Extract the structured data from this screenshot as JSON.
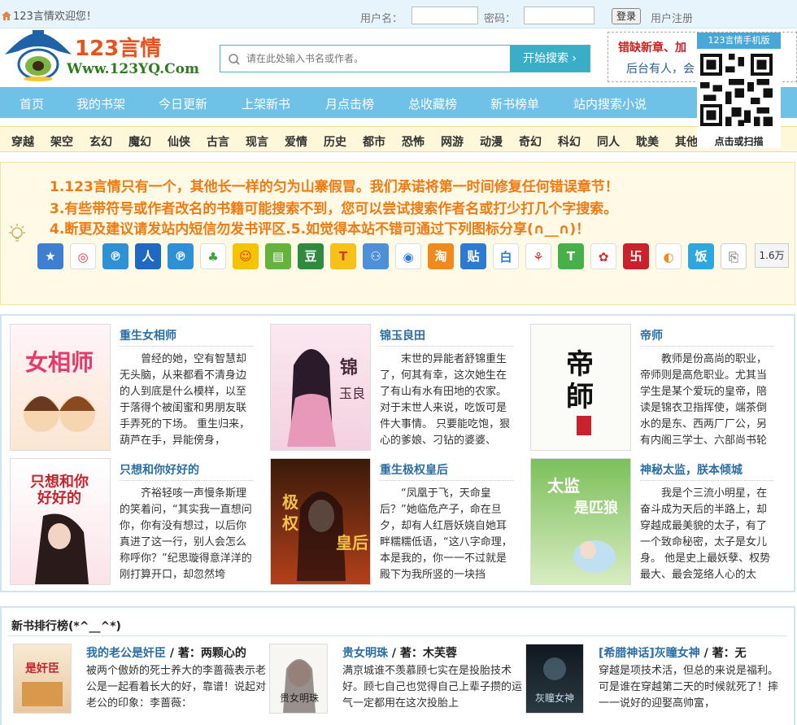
{
  "topbar": {
    "welcome": "123言情欢迎您！",
    "username_label": "用户名：",
    "password_label": "密码：",
    "login_button": "登录",
    "register_link": "用户注册"
  },
  "header": {
    "brand": "123言情",
    "site_url": "Www.123YQ.Com",
    "search_placeholder": "请在此处输入书名或作者。",
    "search_button": "开始搜索",
    "notice_line1": "错缺新章、加",
    "notice_line2": "后台有人，会"
  },
  "nav": [
    "首页",
    "我的书架",
    "今日更新",
    "上架新书",
    "月点击榜",
    "总收藏榜",
    "新书榜单",
    "站内搜索小说"
  ],
  "mobile": {
    "title": "123言情手机版",
    "caption": "点击或扫描"
  },
  "categories": [
    "穿越",
    "架空",
    "玄幻",
    "魔幻",
    "仙侠",
    "古言",
    "现言",
    "爱情",
    "历史",
    "都市",
    "恐怖",
    "网游",
    "动漫",
    "奇幻",
    "科幻",
    "同人",
    "耽美",
    "其他"
  ],
  "announcement": {
    "line1": "1.123言情只有一个，其他长一样的匀为山寨假冒。我们承诺将第一时间修复任何错误章节！",
    "line2": "3.有些带符号或作者改名的书籍可能搜索不到，您可以尝试搜索作者名或打少打几个字搜索。",
    "line3": "4.断更及建议请发站内短信勿发书评区.5.如觉得本站不错可通过下列图标分享(∩__∩)！",
    "share_count": "1.6万"
  },
  "featured": [
    {
      "title": "重生女相师",
      "cover_text": "女相师",
      "desc": "曾经的她，空有智慧却无头脑，从来都看不清身边的人到底是什么模样，以至于落得个被闺蜜和男朋友联手弄死的下场。 重生归来，葫芦在手，异能傍身，"
    },
    {
      "title": "锦玉良田",
      "cover_text": "锦玉良田",
      "desc": "末世的异能者舒锦重生了，何其有幸，这次她生在了有山有水有田地的农家。对于末世人来说，吃饭可是件大事情。 只要能吃饱，狠心的爹娘、刁钻的婆婆、"
    },
    {
      "title": "帝师",
      "cover_text": "帝師",
      "desc": "教师是份高尚的职业，帝师则是高危职业。尤其当学生是某个爱玩的皇帝，陪读是锦衣卫指挥使，端茶倒水的是东、西两厂厂公，另有内阁三学士、六部尚书轮"
    },
    {
      "title": "只想和你好好的",
      "cover_text": "只想和你好好的",
      "desc": "齐裕轻咳一声慢条斯理的笑着问，“其实我一直想问你，你有没有想过，以后你真进了这一行，别人会怎么称呼你？”纪思璇得意洋洋的刚打算开口，却忽然垮"
    },
    {
      "title": "重生极权皇后",
      "cover_text": "极权皇后",
      "desc": "“凤凰于飞，天命皇后？”她临危产子，命在旦夕，却有人红唇妖娆自她耳畔糯糯低语，“这八字命理，本是我的，你一一不过就是殿下为我所竖的一块挡"
    },
    {
      "title": "神秘太监，朕本倾城",
      "cover_text": "太监是匹狼",
      "desc": "我是个三流小明星，在奋斗成为天后的半路上，却穿越成最美貌的太子，有了一个致命秘密，太子是女儿身。 他是史上最妖孽、权势最大、最会笼络人心的太"
    }
  ],
  "ranking": {
    "title": "新书排行榜(*^__^*)",
    "items": [
      {
        "name": "我的老公是奸臣",
        "author": " / 著：两颗心的",
        "cover_text": "是奸臣",
        "desc": "被两个傲娇的死士养大的李蔷薇表示老公是一起看着长大的好，靠谱！说起对老公的印象：李蔷薇："
      },
      {
        "name": "贵女明珠",
        "author": " / 著：木芙蓉",
        "cover_text": "贵女明珠",
        "desc": "满京城谁不羡慕顾七实在是投胎技术好。顾七自己也觉得自己上辈子攒的运气一定都用在这次投胎上"
      },
      {
        "name": "[希腊神话]灰瞳女神",
        "author": " / 著：无",
        "cover_text": "灰瞳女神",
        "desc": "穿越是项技术活，但总的来说是福利。可是谁在穿越第二天的时候就死了！摔一一说好的迎娶高帅富，"
      }
    ]
  },
  "colors": {
    "nav_bg": "#6fc1e7",
    "brand_orange": "#e8531d",
    "announce_text": "#f07a14",
    "link_blue": "#2b6ea6"
  }
}
